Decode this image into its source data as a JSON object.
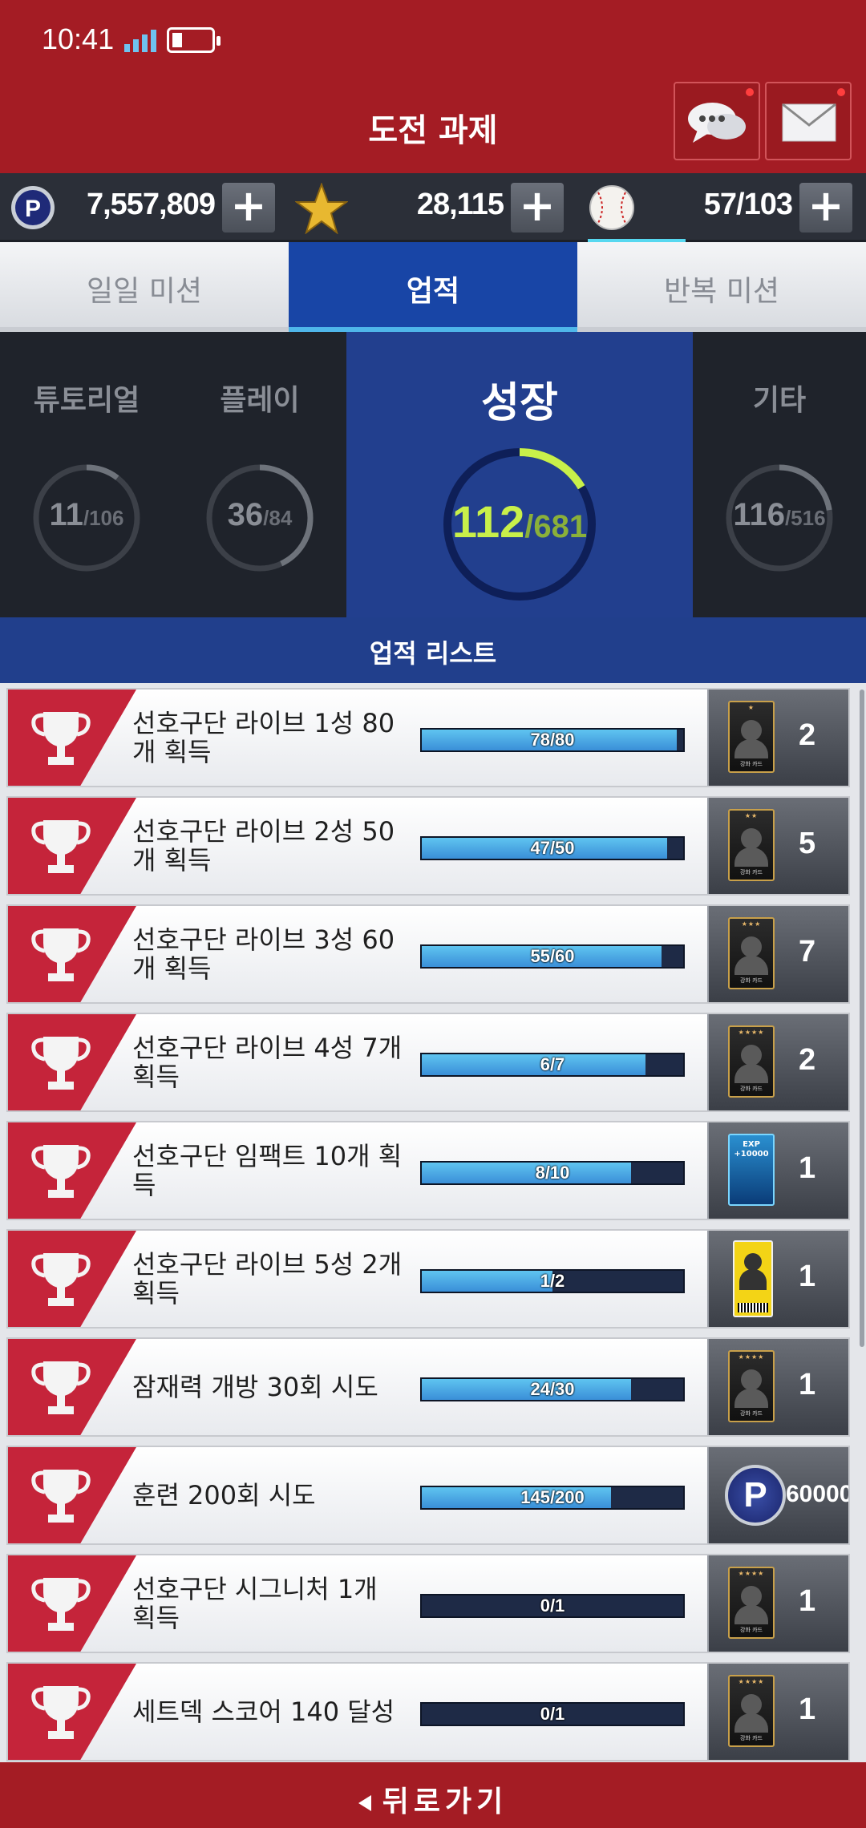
{
  "status_bar": {
    "time": "10:41"
  },
  "header": {
    "title": "도전 과제",
    "chat_icon": "chat-bubbles-icon",
    "mail_icon": "envelope-icon"
  },
  "currency": {
    "points": "7,557,809",
    "stars": "28,115",
    "balls": "57/103",
    "points_icon": "p-coin-icon",
    "stars_icon": "gold-star-icon",
    "balls_icon": "baseball-icon"
  },
  "tabs": [
    {
      "label": "일일 미션",
      "active": false
    },
    {
      "label": "업적",
      "active": true
    },
    {
      "label": "반복 미션",
      "active": false
    }
  ],
  "categories": [
    {
      "label": "튜토리얼",
      "done": "11",
      "total": "/106",
      "progress": 0.104
    },
    {
      "label": "플레이",
      "done": "36",
      "total": "/84",
      "progress": 0.43
    },
    {
      "label": "성장",
      "done": "112",
      "total": "/681",
      "progress": 0.164
    },
    {
      "label": "기타",
      "done": "116",
      "total": "/516",
      "progress": 0.225
    }
  ],
  "list_title": "업적 리스트",
  "achievements": [
    {
      "name": "선호구단 라이브 1성 80개 획득",
      "progress_text": "78/80",
      "progress": 0.975,
      "reward_type": "card",
      "stars": "★",
      "card_caption": "강화 카드",
      "qty": "2"
    },
    {
      "name": "선호구단 라이브 2성 50개 획득",
      "progress_text": "47/50",
      "progress": 0.94,
      "reward_type": "card",
      "stars": "★★",
      "card_caption": "강화 카드",
      "qty": "5"
    },
    {
      "name": "선호구단 라이브 3성 60개 획득",
      "progress_text": "55/60",
      "progress": 0.917,
      "reward_type": "card",
      "stars": "★★★",
      "card_caption": "강화 카드",
      "qty": "7"
    },
    {
      "name": "선호구단 라이브 4성 7개 획득",
      "progress_text": "6/7",
      "progress": 0.857,
      "reward_type": "card",
      "stars": "★★★★",
      "card_caption": "강화 카드",
      "qty": "2"
    },
    {
      "name": "선호구단 임팩트 10개 획득",
      "progress_text": "8/10",
      "progress": 0.8,
      "reward_type": "exp",
      "exp_text": "EXP +10000",
      "qty": "1"
    },
    {
      "name": "선호구단 라이브 5성 2개 획득",
      "progress_text": "1/2",
      "progress": 0.5,
      "reward_type": "ticket",
      "qty": "1"
    },
    {
      "name": "잠재력 개방 30회 시도",
      "progress_text": "24/30",
      "progress": 0.8,
      "reward_type": "card",
      "stars": "★★★★",
      "card_caption": "강화 카드",
      "qty": "1"
    },
    {
      "name": "훈련 200회 시도",
      "progress_text": "145/200",
      "progress": 0.725,
      "reward_type": "coin",
      "coin_label": "P",
      "qty": "60000"
    },
    {
      "name": "선호구단 시그니처 1개 획득",
      "progress_text": "0/1",
      "progress": 0,
      "reward_type": "card",
      "stars": "★★★★",
      "card_caption": "강화 카드",
      "qty": "1"
    },
    {
      "name": "세트덱 스코어 140 달성",
      "progress_text": "0/1",
      "progress": 0,
      "reward_type": "card",
      "stars": "★★★★",
      "card_caption": "강화 카드",
      "qty": "1"
    }
  ],
  "footer": {
    "back_label": "뒤로가기"
  },
  "colors": {
    "header_red": "#a41c24",
    "tab_blue": "#1845a6",
    "ring_green": "#c8f04a",
    "bar_blue": "#4aa8e6"
  }
}
